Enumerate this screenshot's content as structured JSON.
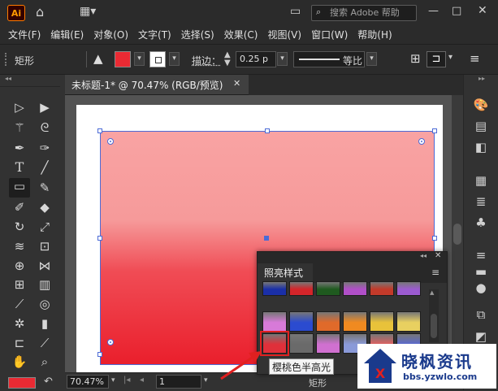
{
  "app": {
    "logo_text": "Ai",
    "search_placeholder": "搜索 Adobe 帮助"
  },
  "menu": [
    "文件(F)",
    "编辑(E)",
    "对象(O)",
    "文字(T)",
    "选择(S)",
    "效果(C)",
    "视图(V)",
    "窗口(W)",
    "帮助(H)"
  ],
  "control_bar": {
    "selection_label": "矩形",
    "stroke_label": "描边：",
    "stroke_value": "0.25 p",
    "profile_label": "等比",
    "fill_color": "#ea2a33"
  },
  "document": {
    "tab_title": "未标题-1* @ 70.47% (RGB/预览)",
    "close_glyph": "✕"
  },
  "status_bar": {
    "zoom": "70.47%",
    "page": "1",
    "tool_name": "矩形"
  },
  "graphic_styles_panel": {
    "title": "照亮样式",
    "swatches": [
      [
        "#1a2fa8",
        "#d4252a",
        "#1f5a1f",
        "#b04fc8",
        "#c23a2a",
        "#9b5bd0"
      ],
      [
        "#d77ad8",
        "#2b4bd0",
        "#e06a2a",
        "#f08a20",
        "#e8c23a",
        "#e8d060"
      ],
      [
        "#e0303a",
        "#6a6a6a",
        "#d070d0",
        "#8a9ad8",
        "#e06060",
        "#5a6ad0"
      ]
    ],
    "tooltip": "樱桃色半高光"
  },
  "watermark": {
    "title": "晓枫资讯",
    "url": "bbs.yzwlo.com"
  }
}
